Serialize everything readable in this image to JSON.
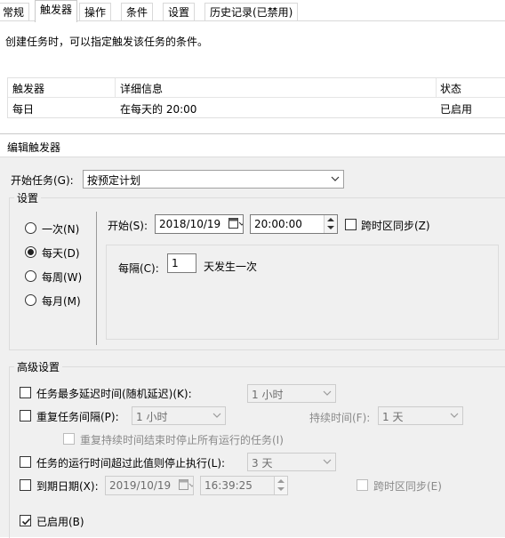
{
  "tabs": [
    {
      "label": "常规"
    },
    {
      "label": "触发器"
    },
    {
      "label": "操作"
    },
    {
      "label": "条件"
    },
    {
      "label": "设置"
    },
    {
      "label": "历史记录(已禁用)"
    }
  ],
  "description": "创建任务时，可以指定触发该任务的条件。",
  "trigger_list": {
    "columns": [
      "触发器",
      "详细信息",
      "状态"
    ],
    "rows": [
      {
        "trigger": "每日",
        "details": "在每天的 20:00",
        "status": "已启用"
      }
    ]
  },
  "dialog": {
    "title": "编辑触发器",
    "begin_task_label": "开始任务(G):",
    "begin_task_value": "按预定计划",
    "settings_group": "设置",
    "radios": [
      "一次(N)",
      "每天(D)",
      "每周(W)",
      "每月(M)"
    ],
    "selected_radio": "每天(D)",
    "start_label": "开始(S):",
    "start_date": "2018/10/19",
    "start_time": "20:00:00",
    "sync_timezone_label": "跨时区同步(Z)",
    "recur_label": "每隔(C):",
    "recur_value": "1",
    "recur_suffix": "天发生一次",
    "advanced_group": "高级设置",
    "delay_label": "任务最多延迟时间(随机延迟)(K):",
    "delay_value": "1 小时",
    "repeat_label": "重复任务间隔(P):",
    "repeat_value": "1 小时",
    "duration_label": "持续时间(F):",
    "duration_value": "1 天",
    "stop_all_label": "重复持续时间结束时停止所有运行的任务(I)",
    "stop_long_label": "任务的运行时间超过此值则停止执行(L):",
    "stop_long_value": "3 天",
    "expire_label": "到期日期(X):",
    "expire_date": "2019/10/19",
    "expire_time": "16:39:25",
    "expire_sync_label": "跨时区同步(E)",
    "enabled_label": "已启用(B)"
  }
}
